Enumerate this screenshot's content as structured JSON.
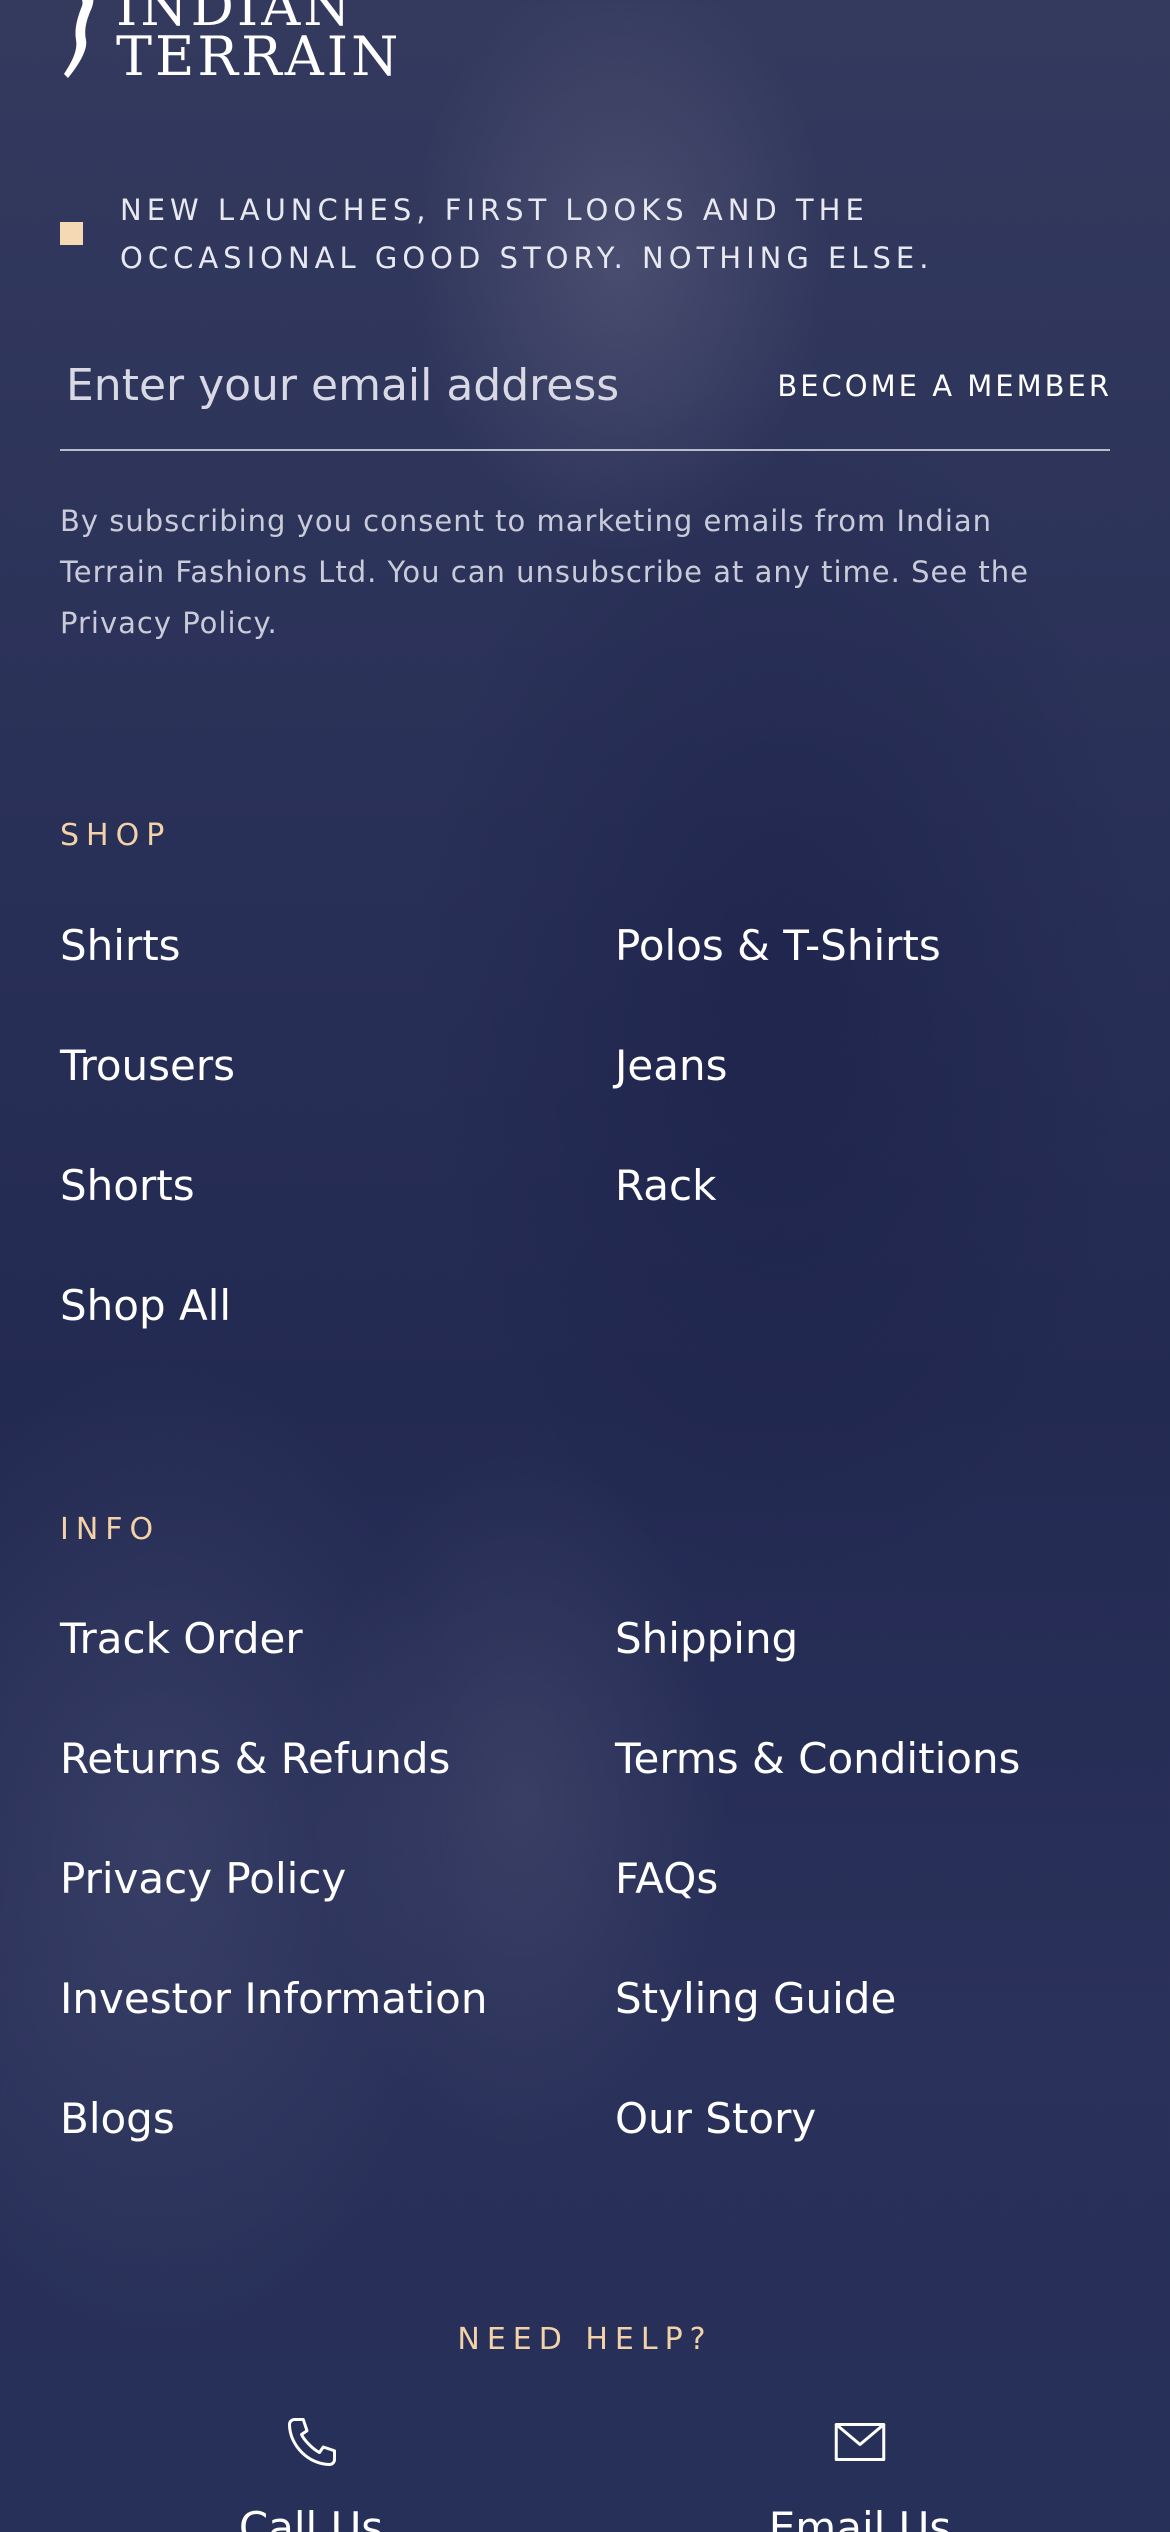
{
  "brand": {
    "line1": "INDIAN",
    "line2": "TERRAIN"
  },
  "newsletter": {
    "tagline": "NEW LAUNCHES, FIRST LOOKS AND THE OCCASIONAL GOOD STORY. NOTHING ELSE.",
    "email_placeholder": "Enter your email address",
    "email_value": "",
    "button_label": "BECOME A MEMBER",
    "consent": "By subscribing you consent to marketing emails from Indian Terrain Fashions Ltd. You can unsubscribe at any time. See the Privacy Policy."
  },
  "shop": {
    "title": "SHOP",
    "links": [
      "Shirts",
      "Polos & T-Shirts",
      "Trousers",
      "Jeans",
      "Shorts",
      "Rack",
      "Shop All"
    ]
  },
  "info": {
    "title": "INFO",
    "links": [
      "Track Order",
      "Shipping",
      "Returns & Refunds",
      "Terms & Conditions",
      "Privacy Policy",
      "FAQs",
      "Investor Information",
      "Styling Guide",
      "Blogs",
      "Our Story"
    ]
  },
  "help": {
    "title": "NEED HELP?",
    "call_label": "Call Us",
    "call_icon": "phone-icon",
    "email_label": "Email Us",
    "email_icon": "mail-icon"
  },
  "colors": {
    "background": "#2a3158",
    "accent": "#f3d2a8",
    "text": "#ffffff"
  }
}
